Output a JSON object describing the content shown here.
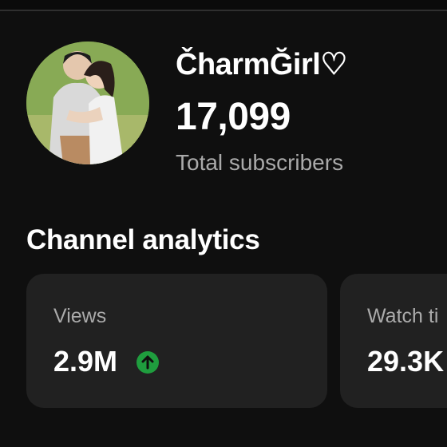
{
  "channel": {
    "name": "ČharmĞirl♡",
    "subscriber_count": "17,099",
    "subscriber_label": "Total subscribers"
  },
  "analytics": {
    "title": "Channel analytics",
    "cards": [
      {
        "label": "Views",
        "value": "2.9M",
        "trend": "up"
      },
      {
        "label": "Watch ti",
        "value": "29.3K"
      }
    ]
  },
  "icons": {
    "trend": "arrow-up-icon"
  },
  "colors": {
    "background": "#0f0f0f",
    "card": "#212121",
    "secondary_text": "#aaaaaa",
    "trend_up": "#1f9d3e"
  }
}
